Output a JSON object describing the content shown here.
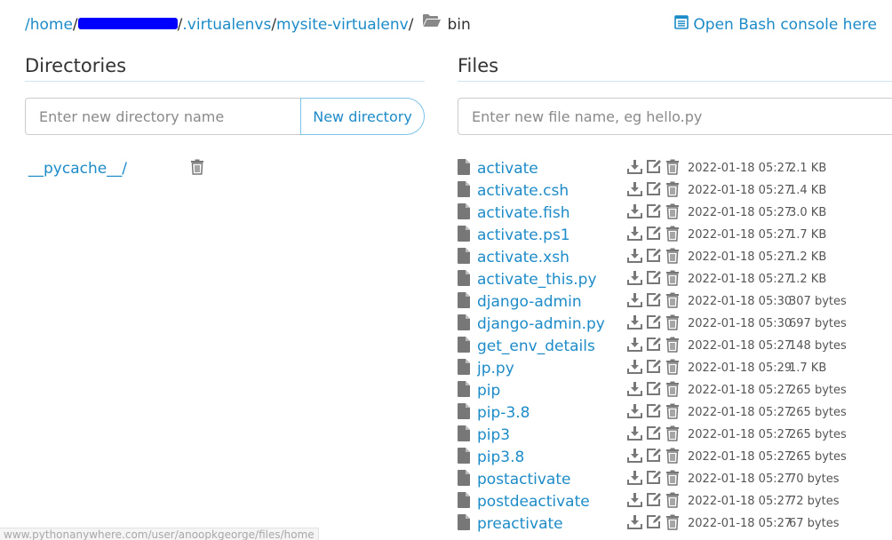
{
  "breadcrumb": {
    "home": "/home",
    "sep1": "/",
    "virtualenvs": ".virtualenvs",
    "sep2": "/",
    "venv": "mysite-virtualenv",
    "sep3": "/",
    "current": "bin"
  },
  "bash_console_label": "Open Bash console here",
  "directories": {
    "title": "Directories",
    "input_placeholder": "Enter new directory name",
    "button_label": "New directory",
    "items": [
      {
        "name": "__pycache__/"
      }
    ]
  },
  "files": {
    "title": "Files",
    "input_placeholder": "Enter new file name, eg hello.py",
    "items": [
      {
        "name": "activate",
        "date": "2022-01-18 05:27",
        "size": "2.1 KB"
      },
      {
        "name": "activate.csh",
        "date": "2022-01-18 05:27",
        "size": "1.4 KB"
      },
      {
        "name": "activate.fish",
        "date": "2022-01-18 05:27",
        "size": "3.0 KB"
      },
      {
        "name": "activate.ps1",
        "date": "2022-01-18 05:27",
        "size": "1.7 KB"
      },
      {
        "name": "activate.xsh",
        "date": "2022-01-18 05:27",
        "size": "1.2 KB"
      },
      {
        "name": "activate_this.py",
        "date": "2022-01-18 05:27",
        "size": "1.2 KB"
      },
      {
        "name": "django-admin",
        "date": "2022-01-18 05:30",
        "size": "307 bytes"
      },
      {
        "name": "django-admin.py",
        "date": "2022-01-18 05:30",
        "size": "697 bytes"
      },
      {
        "name": "get_env_details",
        "date": "2022-01-18 05:27",
        "size": "148 bytes"
      },
      {
        "name": "jp.py",
        "date": "2022-01-18 05:29",
        "size": "1.7 KB"
      },
      {
        "name": "pip",
        "date": "2022-01-18 05:27",
        "size": "265 bytes"
      },
      {
        "name": "pip-3.8",
        "date": "2022-01-18 05:27",
        "size": "265 bytes"
      },
      {
        "name": "pip3",
        "date": "2022-01-18 05:27",
        "size": "265 bytes"
      },
      {
        "name": "pip3.8",
        "date": "2022-01-18 05:27",
        "size": "265 bytes"
      },
      {
        "name": "postactivate",
        "date": "2022-01-18 05:27",
        "size": "70 bytes"
      },
      {
        "name": "postdeactivate",
        "date": "2022-01-18 05:27",
        "size": "72 bytes"
      },
      {
        "name": "preactivate",
        "date": "2022-01-18 05:27",
        "size": "67 bytes"
      }
    ]
  },
  "status_bar_url": "www.pythonanywhere.com/user/anoopkgeorge/files/home",
  "colors": {
    "link": "#1d8bc8",
    "icon": "#777777",
    "redaction": "#0000ff"
  }
}
